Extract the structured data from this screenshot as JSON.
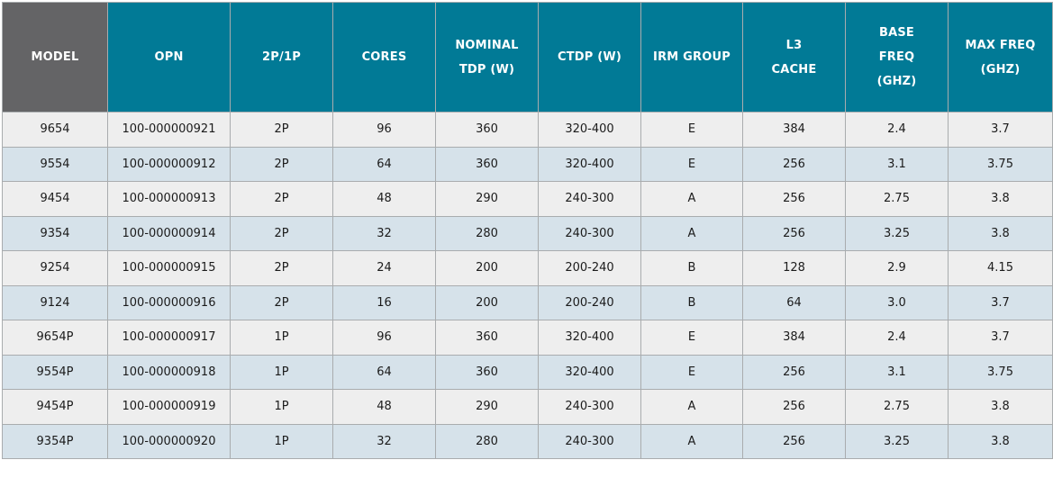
{
  "colors": {
    "header_accent": "#017a96",
    "header_model": "#646466",
    "row_light": "#eeeeee",
    "row_tint": "#d6e2ea"
  },
  "table": {
    "headers": [
      [
        "MODEL"
      ],
      [
        "OPN"
      ],
      [
        "2P/1P"
      ],
      [
        "CORES"
      ],
      [
        "NOMINAL",
        "TDP (W)"
      ],
      [
        "CTDP (W)"
      ],
      [
        "IRM GROUP"
      ],
      [
        "L3",
        "CACHE"
      ],
      [
        "BASE",
        "FREQ",
        "(GHZ)"
      ],
      [
        "MAX FREQ",
        "(GHZ)"
      ]
    ],
    "rows": [
      [
        "9654",
        "100-000000921",
        "2P",
        "96",
        "360",
        "320-400",
        "E",
        "384",
        "2.4",
        "3.7"
      ],
      [
        "9554",
        "100-000000912",
        "2P",
        "64",
        "360",
        "320-400",
        "E",
        "256",
        "3.1",
        "3.75"
      ],
      [
        "9454",
        "100-000000913",
        "2P",
        "48",
        "290",
        "240-300",
        "A",
        "256",
        "2.75",
        "3.8"
      ],
      [
        "9354",
        "100-000000914",
        "2P",
        "32",
        "280",
        "240-300",
        "A",
        "256",
        "3.25",
        "3.8"
      ],
      [
        "9254",
        "100-000000915",
        "2P",
        "24",
        "200",
        "200-240",
        "B",
        "128",
        "2.9",
        "4.15"
      ],
      [
        "9124",
        "100-000000916",
        "2P",
        "16",
        "200",
        "200-240",
        "B",
        "64",
        "3.0",
        "3.7"
      ],
      [
        "9654P",
        "100-000000917",
        "1P",
        "96",
        "360",
        "320-400",
        "E",
        "384",
        "2.4",
        "3.7"
      ],
      [
        "9554P",
        "100-000000918",
        "1P",
        "64",
        "360",
        "320-400",
        "E",
        "256",
        "3.1",
        "3.75"
      ],
      [
        "9454P",
        "100-000000919",
        "1P",
        "48",
        "290",
        "240-300",
        "A",
        "256",
        "2.75",
        "3.8"
      ],
      [
        "9354P",
        "100-000000920",
        "1P",
        "32",
        "280",
        "240-300",
        "A",
        "256",
        "3.25",
        "3.8"
      ]
    ]
  }
}
